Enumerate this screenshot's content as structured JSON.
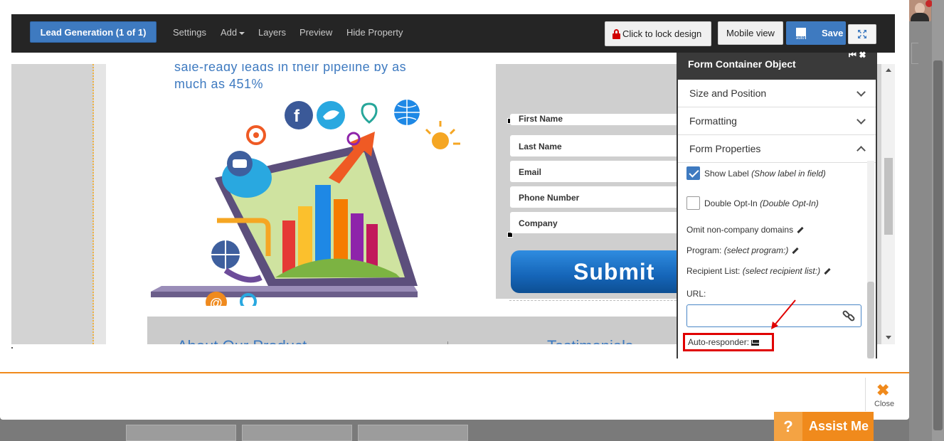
{
  "toolbar": {
    "lead_label": "Lead Generation  (1 of 1)",
    "menu": {
      "settings": "Settings",
      "add": "Add",
      "layers": "Layers",
      "preview": "Preview",
      "hide_property": "Hide Property"
    },
    "lock_label": "Click to lock design",
    "mobile_label": "Mobile view",
    "save_label": "Save"
  },
  "page": {
    "headline_line1": "sale-ready leads in their pipeline by as",
    "headline_line2": "much as 451%",
    "form": {
      "first_name": "First Name",
      "last_name": "Last Name",
      "email": "Email",
      "phone": "Phone Number",
      "company": "Company",
      "submit": "Submit"
    },
    "band_left": "About Our Product",
    "band_right": "Testimonials"
  },
  "panel": {
    "title": "Form Container Object",
    "sections": {
      "size_position": "Size and Position",
      "formatting": "Formatting",
      "form_properties": "Form Properties"
    },
    "show_label": "Show Label",
    "show_label_hint": "(Show label in field)",
    "double_optin": "Double Opt-In",
    "double_optin_hint": "(Double Opt-In)",
    "omit_domains": "Omit non-company domains",
    "program_label": "Program:",
    "program_value": "(select program:)",
    "recipient_label": "Recipient List:",
    "recipient_value": "(select recipient list:)",
    "url_label": "URL:",
    "autoresponder_label": "Auto-responder:"
  },
  "footer": {
    "close_label": "Close",
    "assist_label": "Assist Me",
    "assist_q": "?"
  },
  "colors": {
    "accent_blue": "#3e7ac0",
    "toolbar_dark": "#252525",
    "orange": "#f08a1c",
    "highlight_red": "#e00000"
  }
}
